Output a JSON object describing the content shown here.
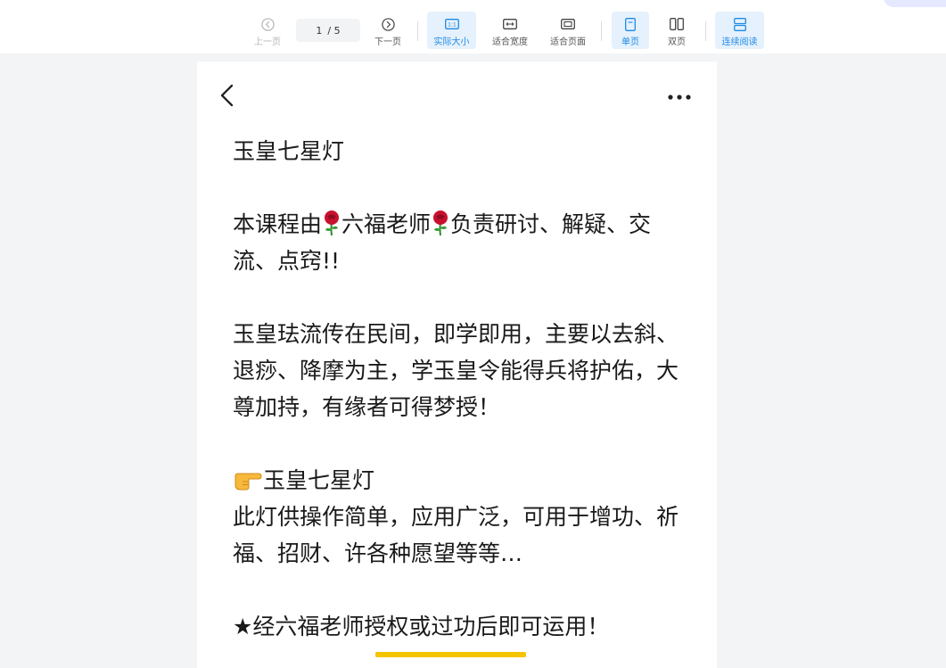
{
  "toolbar": {
    "prev_label": "上一页",
    "next_label": "下一页",
    "current_page": "1",
    "total_pages": "/ 5",
    "actual_size_label": "实际大小",
    "fit_width_label": "适合宽度",
    "fit_page_label": "适合页面",
    "single_page_label": "单页",
    "double_page_label": "双页",
    "continuous_label": "连续阅读",
    "accent_color": "#1f8ae6"
  },
  "document": {
    "title": "玉皇七星灯",
    "intro_before": "本课程由",
    "intro_teacher": "六福老师",
    "intro_after": "负责研讨、解疑、交流、点窍!!",
    "para1": "玉皇珐流传在民间，即学即用，主要以去斜、退痧、降摩为主，学玉皇令能得兵将护佑，大尊加持，有缘者可得梦授！",
    "lamp_heading": "玉皇七星灯",
    "lamp_desc": "此灯供操作简单，应用广泛，可用于增功、祈福、招财、许各种愿望等等…",
    "authorization": "★经六福老师授权或过功后即可运用！"
  },
  "icons": {
    "back": "chevron-left-icon",
    "more": "more-icon",
    "rose": "rose-emoji-icon",
    "hand": "pointing-hand-emoji-icon"
  }
}
